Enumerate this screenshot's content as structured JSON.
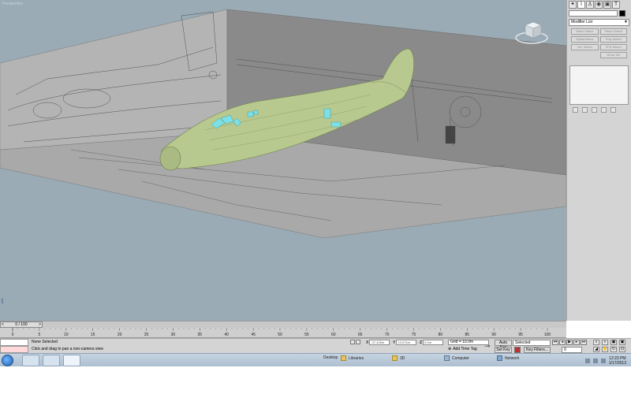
{
  "viewport": {
    "label": "Perspective",
    "background": "#9aabb5",
    "model_color": "#b7c98f",
    "window_color": "#7de0e6"
  },
  "command_panel": {
    "tabs": [
      "create-icon",
      "modify-icon",
      "hierarchy-icon",
      "motion-icon",
      "display-icon",
      "utilities-icon"
    ],
    "modifier_list": "Modifier List",
    "selection_buttons": [
      "Mesh Select",
      "Patch Select",
      "SplineSelect",
      "Poly Select",
      "Vol. Select",
      "FFD Select",
      "",
      "NSurf Sel"
    ]
  },
  "timeline": {
    "slider": "0 / 100",
    "ticks": [
      "0",
      "5",
      "10",
      "15",
      "20",
      "25",
      "30",
      "35",
      "40",
      "45",
      "50",
      "55",
      "60",
      "65",
      "70",
      "75",
      "80",
      "85",
      "90",
      "95",
      "100"
    ]
  },
  "status": {
    "selection": "None Selected",
    "prompt": "Click and drag to pan a non-camera view",
    "x_label": "X",
    "x_value": "-37.425m",
    "y_label": "Y",
    "y_value": "19.074m",
    "z_label": "Z",
    "z_value": "0.0m",
    "grid": "Grid = 10.0m",
    "add_time_tag": "Add Time Tag",
    "auto_key": "Auto Key",
    "set_key": "Set Key",
    "selected_dropdown": "Selected",
    "key_filters": "Key Filters...",
    "frame": "0"
  },
  "taskbar": {
    "desktop": "Desktop",
    "libraries": "Libraries",
    "folder_3d": "3D",
    "computer": "Computer",
    "network": "Network",
    "time": "12:23 PM",
    "date": "1/17/2013"
  }
}
